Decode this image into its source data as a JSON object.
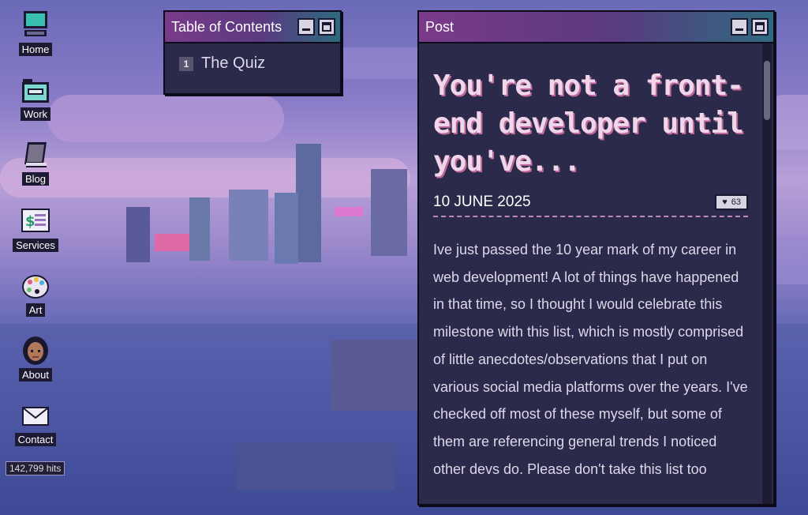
{
  "desktop": {
    "icons": [
      {
        "label": "Home",
        "icon": "computer-icon"
      },
      {
        "label": "Work",
        "icon": "folder-icon"
      },
      {
        "label": "Blog",
        "icon": "notebook-icon"
      },
      {
        "label": "Services",
        "icon": "invoice-icon"
      },
      {
        "label": "Art",
        "icon": "palette-icon"
      },
      {
        "label": "About",
        "icon": "avatar-icon"
      },
      {
        "label": "Contact",
        "icon": "envelope-icon"
      }
    ],
    "hits": "142,799 hits"
  },
  "toc_window": {
    "title": "Table of Contents",
    "items": [
      {
        "number": "1",
        "label": "The Quiz"
      }
    ]
  },
  "post_window": {
    "title": "Post",
    "heading": "You're not a front-end developer until you've...",
    "date": "10 JUNE 2025",
    "likes": "63",
    "body": "Ive just passed the 10 year mark of my career in web development! A lot of things have happened in that time, so I thought I would celebrate this milestone with this list, which is mostly comprised of little anecdotes/observations that I put on various social media platforms over the years. I've checked off most of these myself, but some of them are referencing general trends I noticed other devs do. Please don't take this list too"
  },
  "colors": {
    "titlebar_start": "#7a3a8a",
    "titlebar_end": "#2e6a80",
    "window_bg": "#2c2a4a",
    "heading": "#f0d6ea"
  }
}
